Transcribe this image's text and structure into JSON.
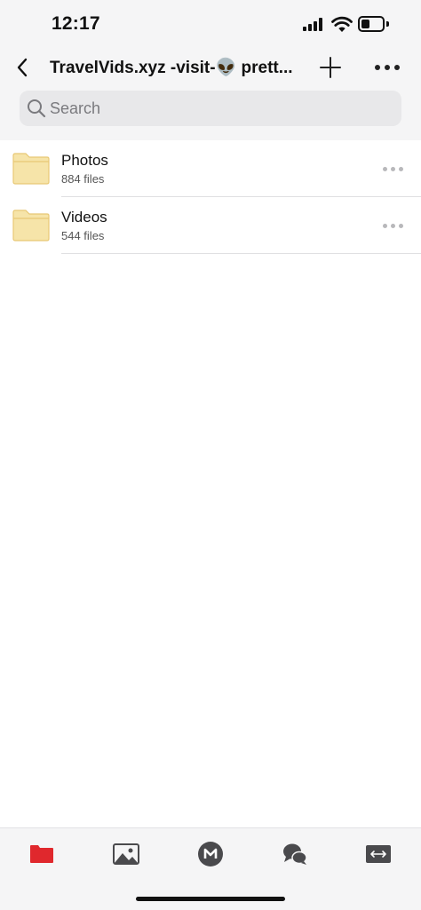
{
  "status_bar": {
    "time": "12:17",
    "icons": [
      "cellular-signal-icon",
      "wifi-icon",
      "battery-icon"
    ]
  },
  "nav": {
    "back_icon": "chevron-left-icon",
    "title": "TravelVids.xyz -visit-👽 prett...",
    "add_icon": "plus-icon",
    "more_icon": "more-horizontal-icon"
  },
  "search": {
    "placeholder": "Search",
    "value": ""
  },
  "files": [
    {
      "name": "Photos",
      "count": "884 files",
      "icon": "folder-icon"
    },
    {
      "name": "Videos",
      "count": "544 files",
      "icon": "folder-icon"
    }
  ],
  "tab_bar": {
    "tabs": [
      {
        "id": "cloud-drive",
        "icon": "folder-tab-icon",
        "active": true
      },
      {
        "id": "photos",
        "icon": "image-tab-icon",
        "active": false
      },
      {
        "id": "home",
        "icon": "mega-logo-icon",
        "active": false
      },
      {
        "id": "chat",
        "icon": "chat-bubbles-icon",
        "active": false
      },
      {
        "id": "transfers",
        "icon": "transfers-icon",
        "active": false
      }
    ]
  },
  "colors": {
    "accent": "#e0282d",
    "folder_fill": "#f6e4a9",
    "folder_stroke": "#e8c874",
    "background_top": "#f5f5f6",
    "icon_gray": "#4a4a4d"
  }
}
